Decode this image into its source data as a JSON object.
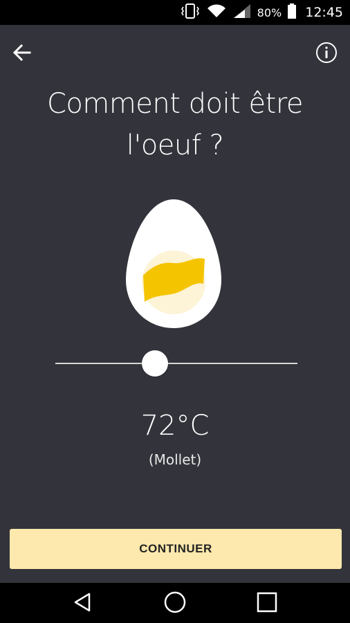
{
  "status_bar": {
    "battery": "80%",
    "time": "12:45",
    "icons": [
      "phone-vibrate-icon",
      "wifi-icon",
      "signal-icon",
      "battery-icon"
    ]
  },
  "header": {
    "back_icon": "arrow-left-icon",
    "info_icon": "info-icon"
  },
  "title_line1": "Comment doit être",
  "title_line2": "l'oeuf ?",
  "slider": {
    "value_fraction": 0.41
  },
  "temperature": "72°C",
  "doneness": "(Mollet)",
  "continue_label": "CONTINUER",
  "nav": {
    "icons": [
      "back-triangle-icon",
      "home-circle-icon",
      "recents-square-icon"
    ]
  },
  "colors": {
    "background": "#33343b",
    "button": "#fde9ad",
    "yolk": "#f5c400"
  }
}
